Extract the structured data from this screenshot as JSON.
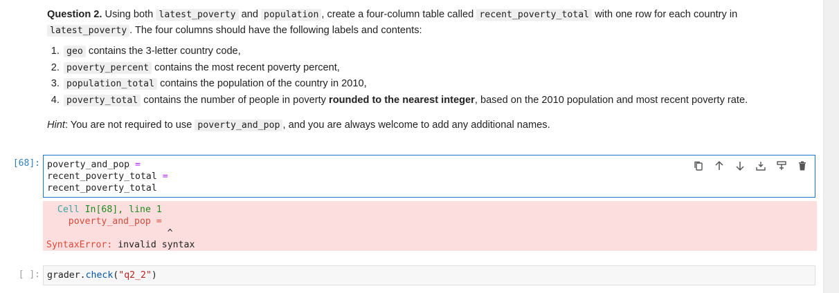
{
  "question": {
    "title": "Question 2.",
    "intro_1": "Using both",
    "code_latest_poverty": "latest_poverty",
    "and": "and",
    "code_population": "population",
    "intro_2": ", create a four-column table called",
    "code_recent_poverty_total": "recent_poverty_total",
    "intro_3": "with one row for each country in",
    "intro_4": ". The four columns should have the following labels and contents:",
    "items": [
      {
        "code": "geo",
        "text": "contains the 3-letter country code,"
      },
      {
        "code": "poverty_percent",
        "text": "contains the most recent poverty percent,"
      },
      {
        "code": "population_total",
        "text": "contains the population of the country in 2010,"
      },
      {
        "code": "poverty_total",
        "text_before": "contains the number of people in poverty",
        "bold": "rounded to the nearest integer",
        "text_after": ", based on the 2010 population and most recent poverty rate."
      }
    ],
    "hint_label": "Hint",
    "hint_1": ": You are not required to use",
    "hint_code": "poverty_and_pop",
    "hint_2": ", and you are always welcome to add any additional names."
  },
  "cell_68": {
    "prompt": "[68]:",
    "line1_var": "poverty_and_pop",
    "line2_var": "recent_poverty_total",
    "op": "=",
    "line3": "recent_poverty_total",
    "toolbar": {
      "duplicate": "copy-icon",
      "move_up": "arrow-up-icon",
      "move_down": "arrow-down-icon",
      "insert_above": "insert-above-icon",
      "insert_below": "insert-below-icon",
      "delete": "trash-icon"
    }
  },
  "error_output": {
    "cell_label": "Cell",
    "cell_ref": "In[68], line 1",
    "code_line": "poverty_and_pop =",
    "caret": "^",
    "error_name": "SyntaxError:",
    "error_msg": "invalid syntax"
  },
  "cell_next": {
    "prompt": "[ ]:",
    "obj": "grader",
    "dot": ".",
    "method": "check",
    "paren_open": "(",
    "arg": "\"q2_2\"",
    "paren_close": ")"
  },
  "colors": {
    "active_border": "#1976d2",
    "error_bg": "#fddede",
    "prompt_blue": "#307fc1"
  }
}
